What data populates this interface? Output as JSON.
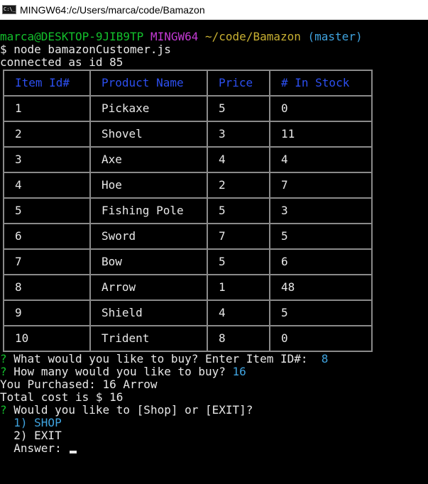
{
  "window": {
    "title": "MINGW64:/c/Users/marca/code/Bamazon",
    "icon_text": "C:\\_"
  },
  "terminal": {
    "prompt_user": "marca@DESKTOP-9JIB9TP",
    "prompt_env": "MINGW64",
    "prompt_path": "~/code/Bamazon",
    "prompt_branch": "(master)",
    "command": "$ node bamazonCustomer.js",
    "connected": "connected as id 85",
    "table": {
      "headers": [
        "Item Id#",
        "Product Name",
        "Price",
        "# In Stock"
      ],
      "rows": [
        [
          "1",
          "Pickaxe",
          "5",
          "0"
        ],
        [
          "2",
          "Shovel",
          "3",
          "11"
        ],
        [
          "3",
          "Axe",
          "4",
          "4"
        ],
        [
          "4",
          "Hoe",
          "2",
          "7"
        ],
        [
          "5",
          "Fishing Pole",
          "5",
          "3"
        ],
        [
          "6",
          "Sword",
          "7",
          "5"
        ],
        [
          "7",
          "Bow",
          "5",
          "6"
        ],
        [
          "8",
          "Arrow",
          "1",
          "48"
        ],
        [
          "9",
          "Shield",
          "4",
          "5"
        ],
        [
          "10",
          "Trident",
          "8",
          "0"
        ]
      ]
    },
    "q_mark": "?",
    "q1_text": "What would you like to buy? Enter Item ID#:",
    "q1_answer": "8",
    "q2_text": "How many would you like to buy?",
    "q2_answer": "16",
    "purchased": "You Purchased: 16 Arrow",
    "total": "Total cost is $ 16",
    "q3_text": "Would you like to [Shop] or [EXIT]?",
    "option1": "1) SHOP",
    "option2": "2) EXIT",
    "answer_label": "Answer:"
  }
}
